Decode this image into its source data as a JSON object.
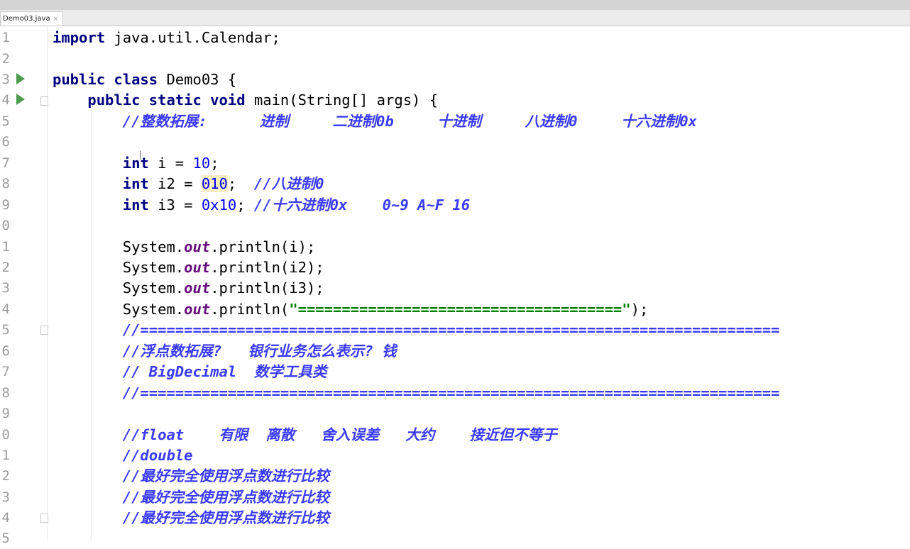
{
  "tab": {
    "filename": "Demo03.java",
    "close": "×"
  },
  "line_numbers": [
    "1",
    "2",
    "3",
    "4",
    "5",
    "6",
    "7",
    "8",
    "9",
    "0",
    "1",
    "2",
    "3",
    "4",
    "5",
    "6",
    "7",
    "8",
    "9",
    "0",
    "1",
    "2",
    "3",
    "4",
    "5"
  ],
  "code": {
    "l1": {
      "kw": "import",
      "rest": " java.util.Calendar;"
    },
    "l3": {
      "kw": "public class",
      "rest": " Demo03 {"
    },
    "l4": {
      "indent": "    ",
      "kw": "public static void",
      "rest": " main(String[] args) {"
    },
    "l5": {
      "indent": "        ",
      "comment": "//整数拓展:      进制     二进制0b     十进制     八进制0     十六进制0x"
    },
    "l7": {
      "indent": "        ",
      "kw": "int",
      "mid": " i = ",
      "num": "10",
      "end": ";"
    },
    "l8": {
      "indent": "        ",
      "kw": "int",
      "mid": " i2 = ",
      "num": "010",
      "end": ";  ",
      "comment": "//八进制0"
    },
    "l9": {
      "indent": "        ",
      "kw": "int",
      "mid": " i3 = ",
      "num": "0x10",
      "end": "; ",
      "comment": "//十六进制0x    0~9 A~F 16"
    },
    "l11": {
      "indent": "        ",
      "a": "System.",
      "field": "out",
      "b": ".println(i);"
    },
    "l12": {
      "indent": "        ",
      "a": "System.",
      "field": "out",
      "b": ".println(i2);"
    },
    "l13": {
      "indent": "        ",
      "a": "System.",
      "field": "out",
      "b": ".println(i3);"
    },
    "l14": {
      "indent": "        ",
      "a": "System.",
      "field": "out",
      "b": ".println(",
      "str": "\"=====================================\"",
      "c": ");"
    },
    "l15": {
      "indent": "        ",
      "comment": "//========================================================================="
    },
    "l16": {
      "indent": "        ",
      "comment": "//浮点数拓展?   银行业务怎么表示? 钱"
    },
    "l17": {
      "indent": "        ",
      "comment": "// BigDecimal  数学工具类"
    },
    "l18": {
      "indent": "        ",
      "comment": "//========================================================================="
    },
    "l20": {
      "indent": "        ",
      "comment": "//float    有限  离散   舍入误差   大约    接近但不等于"
    },
    "l21": {
      "indent": "        ",
      "comment": "//double"
    },
    "l22": {
      "indent": "        ",
      "comment": "//最好完全使用浮点数进行比较"
    },
    "l23": {
      "indent": "        ",
      "comment": "//最好完全使用浮点数进行比较"
    },
    "l24": {
      "indent": "        ",
      "comment": "//最好完全使用浮点数进行比较"
    }
  },
  "colors": {
    "keyword": "#000080",
    "number": "#0000ff",
    "comment": "#3a3aff",
    "string": "#008000",
    "field": "#660e7a",
    "run_icon": "#4a9b4a"
  },
  "icons": [
    "run-gutter-icon",
    "fold-marker-icon",
    "close-tab-icon"
  ]
}
